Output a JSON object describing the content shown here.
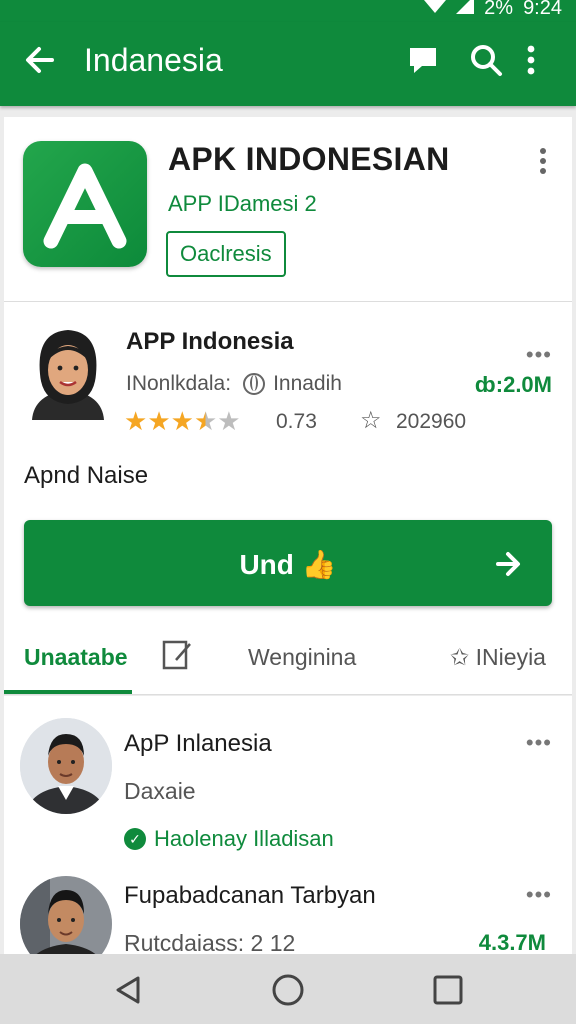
{
  "status_bar": {
    "battery": "2%",
    "time": "9:24"
  },
  "appbar": {
    "title": "Indanesia"
  },
  "app": {
    "name": "APK INDONESIAN",
    "subtitle": "APP IDamesi 2",
    "badge": "Oaclresis"
  },
  "developer": {
    "name": "APP Indonesia",
    "label": "INonlkdala:",
    "location": "Innadih",
    "size": "ȸ:2.0M",
    "rating_value": 3.5,
    "rating_text": "0.73",
    "downloads": "202960",
    "description": "Apnd Naise",
    "install_label": "Und"
  },
  "tabs": [
    {
      "label": "Unaatabe"
    },
    {
      "label": "Wenginina"
    },
    {
      "label": "INieyia"
    }
  ],
  "list": [
    {
      "title": "ApP Inlanesia",
      "subtitle": "Daxaie",
      "tag": "Haolenay Illadisan"
    },
    {
      "title": "Fupabadcanan Tarbyan",
      "subtitle": "Rutcdaiass: 2 12",
      "size": "4.3.7M"
    }
  ],
  "colors": {
    "accent": "#0f8a3c",
    "star": "#f5a623"
  }
}
